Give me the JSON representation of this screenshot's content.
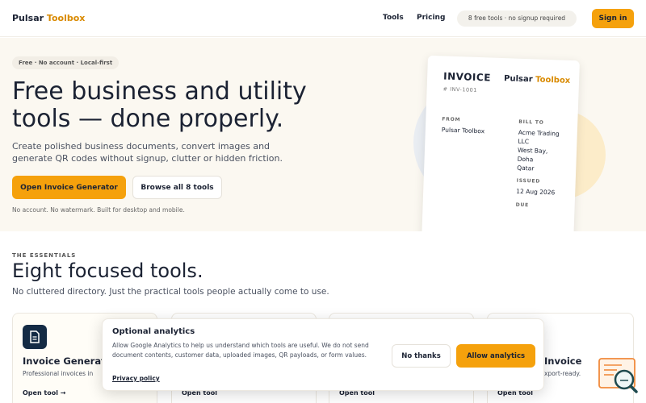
{
  "header": {
    "logo_main": "Pulsar",
    "logo_accent": "Toolbox",
    "nav": {
      "tools": "Tools",
      "pricing": "Pricing"
    },
    "badge": "8 free tools · no signup required",
    "signin": "Sign in"
  },
  "hero": {
    "pill": "Free · No account · Local-first",
    "title": "Free business and utility tools — done properly.",
    "subtitle": "Create polished business documents, convert images and generate QR codes without signup, clutter or hidden friction.",
    "primary_cta": "Open Invoice Generator",
    "secondary_cta": "Browse all 8 tools",
    "note": "No account. No watermark. Built for desktop and mobile."
  },
  "invoice": {
    "title": "INVOICE",
    "brand_main": "Pulsar",
    "brand_accent": "Toolbox",
    "number": "# INV-1001",
    "from_label": "FROM",
    "from_value": "Pulsar Toolbox",
    "billto_label": "BILL TO",
    "billto_lines": [
      "Acme Trading",
      "LLC",
      "West Bay,",
      "Doha",
      "Qatar"
    ],
    "issued_label": "ISSUED",
    "issued_value": "12 Aug 2026",
    "due_label": "DUE"
  },
  "essentials": {
    "kicker": "THE ESSENTIALS",
    "title": "Eight focused tools.",
    "subtitle": "No cluttered directory. Just the practical tools people actually come to use."
  },
  "tools": [
    {
      "name": "Invoice Generator",
      "desc": "Professional invoices in",
      "link": "Open tool →"
    },
    {
      "link": "Open tool"
    },
    {
      "link": "Open tool"
    },
    {
      "name": "Invoice",
      "desc": "xport-ready.",
      "link": "Open tool"
    }
  ],
  "consent": {
    "title": "Optional analytics",
    "text": "Allow Google Analytics to help us understand which tools are useful. We do not send document contents, customer data, uploaded images, QR payloads, or form values.",
    "policy_link": "Privacy policy",
    "decline": "No thanks",
    "accept": "Allow analytics"
  },
  "colors": {
    "accent": "#f5a10c",
    "brand_accent": "#d98a00",
    "navy": "#142b45",
    "hero_bg": "#fbf8f1"
  },
  "icons": {
    "invoice_tool": "document-icon",
    "floating_widget": "search-magnifier-icon"
  }
}
